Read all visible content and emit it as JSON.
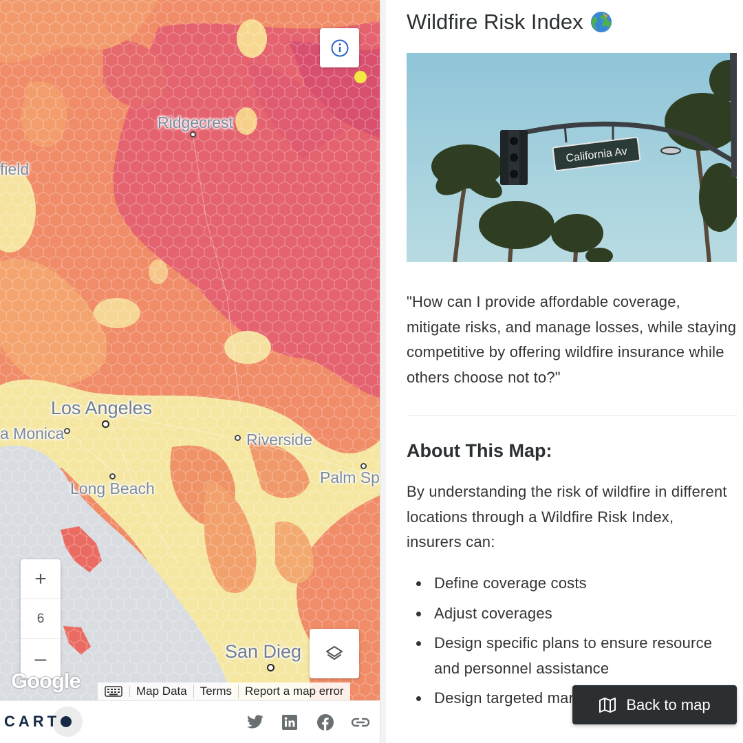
{
  "map": {
    "places": {
      "ridgecrest": "Ridgecrest",
      "bakersfield_partial": "field",
      "los_angeles": "Los Angeles",
      "santa_monica_partial": "a Monica",
      "riverside": "Riverside",
      "long_beach": "Long Beach",
      "palm_springs_partial": "Palm Spr",
      "san_diego_partial": "San Dieg"
    },
    "zoom_in_label": "+",
    "zoom_level": "6",
    "zoom_out_label": "–",
    "google_logo": "Google",
    "attribution": {
      "map_data": "Map Data",
      "terms": "Terms",
      "report": "Report a map error"
    },
    "colors": {
      "high_risk": "#e0646e",
      "mid_risk": "#f08a66",
      "low_mid_risk": "#f7b274",
      "low_risk": "#f6e7a0",
      "water": "#d9dde2"
    },
    "icons": [
      "info-icon",
      "layers-icon",
      "keyboard-icon"
    ]
  },
  "footer": {
    "logo_text": "CART",
    "social": [
      "twitter-icon",
      "linkedin-icon",
      "facebook-icon",
      "link-icon"
    ]
  },
  "panel": {
    "title": "Wildfire Risk Index",
    "title_emoji": "globe-icon",
    "photo_sign": "California Av",
    "quote": "\"How can I provide affordable coverage, mitigate risks, and manage losses, while staying competitive by offering wildfire insurance while others choose not to?\"",
    "about_heading": "About This Map:",
    "about_text": "By understanding the risk of wildfire in different locations through a Wildfire Risk Index, insurers can:",
    "bullets": [
      "Define coverage costs",
      "Adjust coverages",
      "Design specific plans to ensure resource and personnel assistance",
      "Design targeted marketing campaigns"
    ],
    "back_button": "Back to map"
  }
}
